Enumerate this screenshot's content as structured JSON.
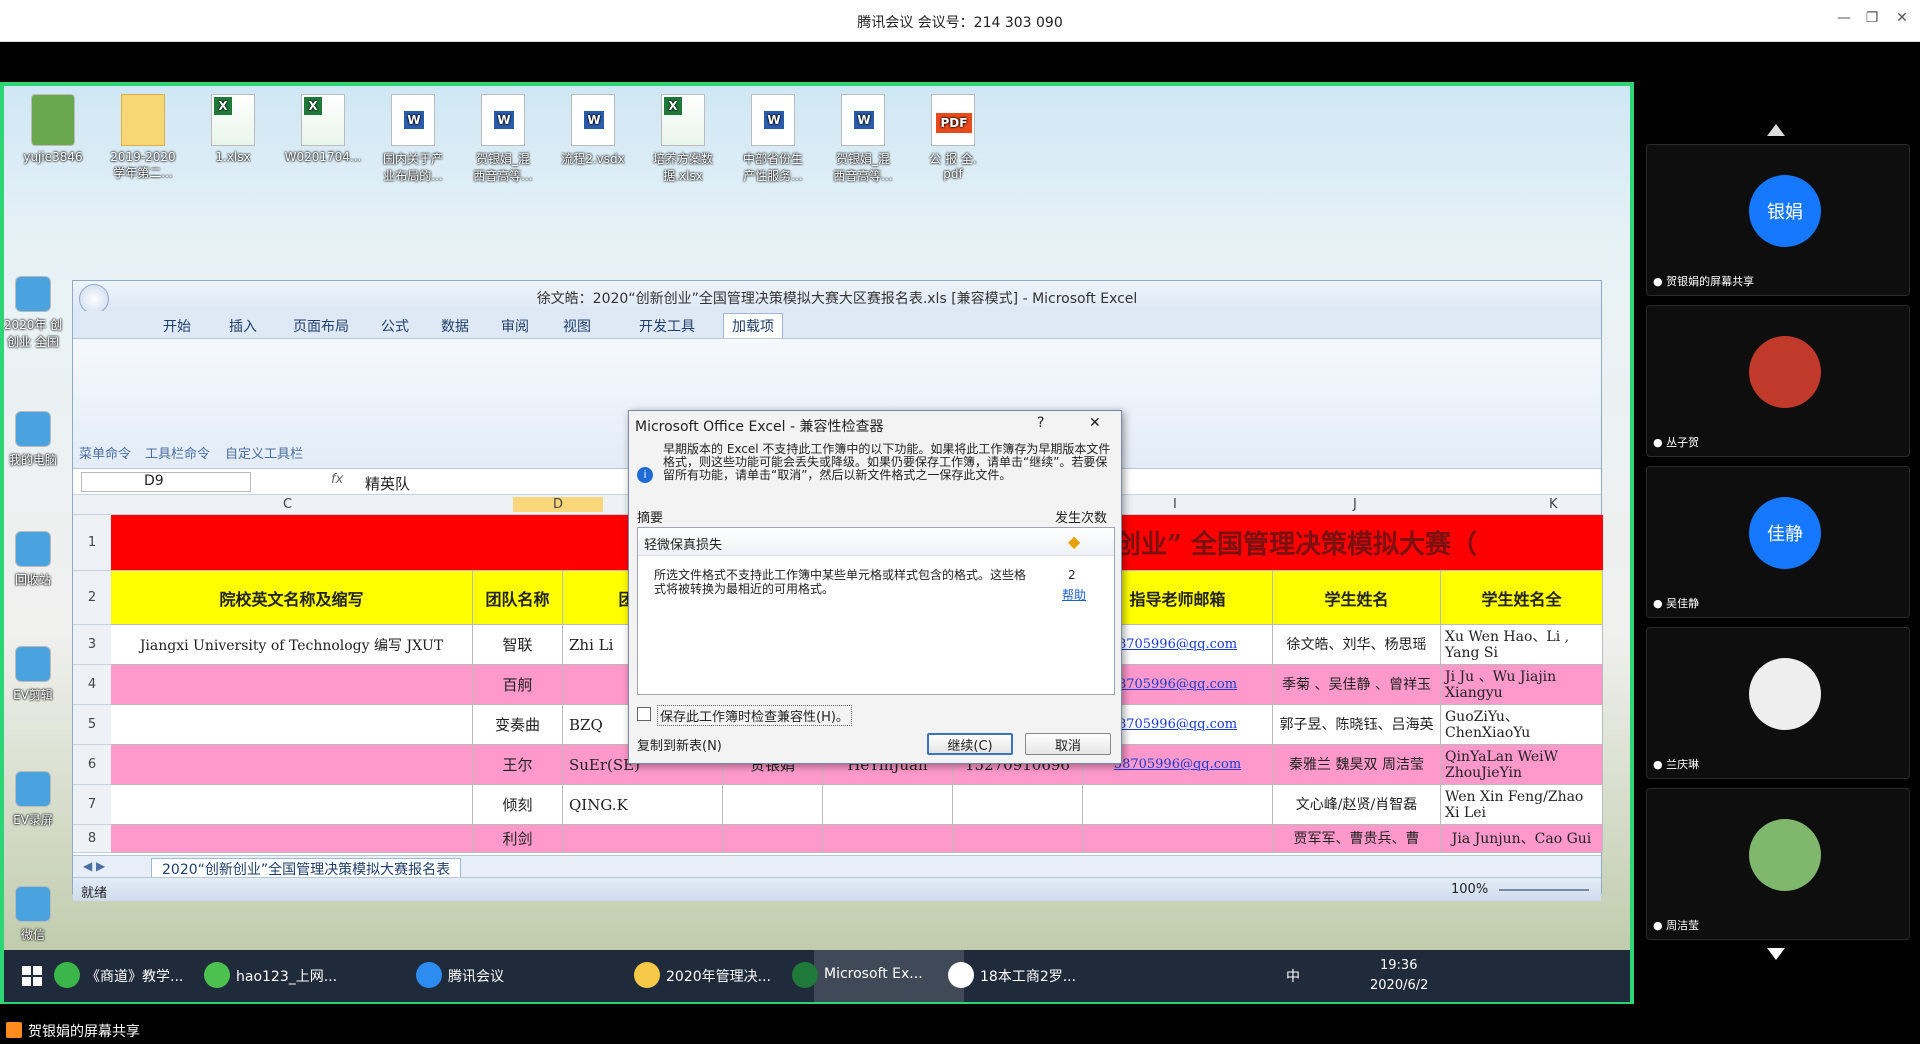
{
  "meeting": {
    "title": "腾讯会议 会议号：214 303 090",
    "min": "—",
    "restore": "❐",
    "close": "✕"
  },
  "desktop": {
    "icons": [
      {
        "label": "yujie3846",
        "type": "u"
      },
      {
        "label": "2019-2020\n学年第二...",
        "type": "f"
      },
      {
        "label": "1.xlsx",
        "type": "x"
      },
      {
        "label": "W0201704...",
        "type": "x"
      },
      {
        "label": "国内关于产\n业布局的...",
        "type": "w"
      },
      {
        "label": "贺银娟_混\n西音高等...",
        "type": "w"
      },
      {
        "label": "流程2.vsdx",
        "type": "w"
      },
      {
        "label": "培养方案数\n据.xlsx",
        "type": "x"
      },
      {
        "label": "中部省份生\n产性服务...",
        "type": "w"
      },
      {
        "label": "贺银娟_混\n西音高等...",
        "type": "w"
      },
      {
        "label": "公 报 全.\npdf",
        "type": "p"
      }
    ],
    "left": [
      "2020年 创\n创业 全国",
      "我的电脑",
      "回收站",
      "EV剪辑",
      "EV录屏",
      "微信"
    ]
  },
  "excel": {
    "title": "徐文皓：2020“创新创业”全国管理决策模拟大赛大区赛报名表.xls  [兼容模式] - Microsoft Excel",
    "tabs": [
      "开始",
      "插入",
      "页面布局",
      "公式",
      "数据",
      "审阅",
      "视图",
      "开发工具",
      "加载项"
    ],
    "groups": [
      "菜单命令",
      "工具栏命令",
      "自定义工具栏"
    ],
    "namebox": "D9",
    "fx": "fx",
    "formula": "精英队",
    "cols": [
      "C",
      "D",
      "I",
      "J",
      "K"
    ],
    "banner": "新创业” 全国管理决策模拟大赛（",
    "headers": [
      "院校英文名称及缩写",
      "团队名称",
      "团队英",
      "指导老师邮箱",
      "学生姓名",
      "学生姓名全"
    ],
    "rows": [
      {
        "n": "3",
        "c": "Jiangxi University of Technology 编写 JXUT",
        "d": "智联",
        "e": "Zhi Li",
        "i": "8705996@qq.com",
        "j": "徐文皓、刘华、杨思瑶",
        "k": "Xu Wen Hao、Li , Yang Si"
      },
      {
        "n": "4",
        "c": "",
        "d": "百舸",
        "e": "",
        "i": "8705996@qq.com",
        "j": "季菊 、吴佳静 、曾祥玉",
        "k": "Ji Ju 、Wu Jiajin Xiangyu"
      },
      {
        "n": "5",
        "c": "",
        "d": "变奏曲",
        "e": "BZQ",
        "i": "8705996@qq.com",
        "j": "郭子昱、陈晓钰、吕海英",
        "k": "GuoZiYu、ChenXiaoYu"
      },
      {
        "n": "6",
        "c": "",
        "d": "王尔",
        "e": "SuEr(SE)",
        "f": "贺银娟",
        "g": "HeYinJuan",
        "h": "15270910696",
        "i": "58705996@qq.com",
        "j": "秦雅兰 魏昊双 周洁莹",
        "k": "QinYaLan  WeiW ZhouJieYin"
      },
      {
        "n": "7",
        "c": "",
        "d": "倾刻",
        "e": "QING.K",
        "i": "",
        "j": "文心峰/赵贤/肖智磊",
        "k": "Wen Xin Feng/Zhao Xi Lei"
      },
      {
        "n": "8",
        "c": "",
        "d": "利剑",
        "e": "",
        "i": "",
        "j": "贾军军、曹贵兵、曹",
        "k": "Jia Junjun、Cao Gui"
      }
    ],
    "sheet": "2020“创新创业”全国管理决策模拟大赛报名表",
    "status": "就绪",
    "zoom": "100%"
  },
  "dialog": {
    "title": "Microsoft Office Excel - 兼容性检查器",
    "help": "?",
    "close": "✕",
    "message": "早期版本的 Excel 不支持此工作簿中的以下功能。如果将此工作簿存为早期版本文件格式，则这些功能可能会丢失或降级。如果仍要保存工作簿，请单击“继续”。若要保留所有功能，请单击“取消”，然后以新文件格式之一保存此文件。",
    "summary": "摘要",
    "count_h": "发生次数",
    "issue_title": "轻微保真损失",
    "issue_text": "所选文件格式不支持此工作簿中某些单元格或样式包含的格式。这些格式将被转换为最相近的可用格式。",
    "count": "2",
    "help_link": "帮助",
    "check": "保存此工作簿时检查兼容性(H)。",
    "copy": "复制到新表(N)",
    "continue": "继续(C)",
    "cancel": "取消"
  },
  "taskbar": {
    "items": [
      "《商道》教学...",
      "hao123_上网...",
      "腾讯会议",
      "2020年管理决...",
      "Microsoft Ex...",
      "18本工商2罗..."
    ],
    "ime": "中",
    "time": "19:36",
    "date": "2020/6/2"
  },
  "panel": {
    "people": [
      {
        "avatar": "银娟",
        "name": "贺银娟的屏幕共享",
        "color": "#1677ff"
      },
      {
        "avatar": "",
        "name": "丛子贺",
        "color": "#c0392b"
      },
      {
        "avatar": "佳静",
        "name": "吴佳静",
        "color": "#1677ff"
      },
      {
        "avatar": "",
        "name": "兰庆琳",
        "color": "#eeeeee"
      },
      {
        "avatar": "",
        "name": "周洁莹",
        "color": "#7fb86d"
      }
    ]
  },
  "footer": "贺银娟的屏幕共享"
}
